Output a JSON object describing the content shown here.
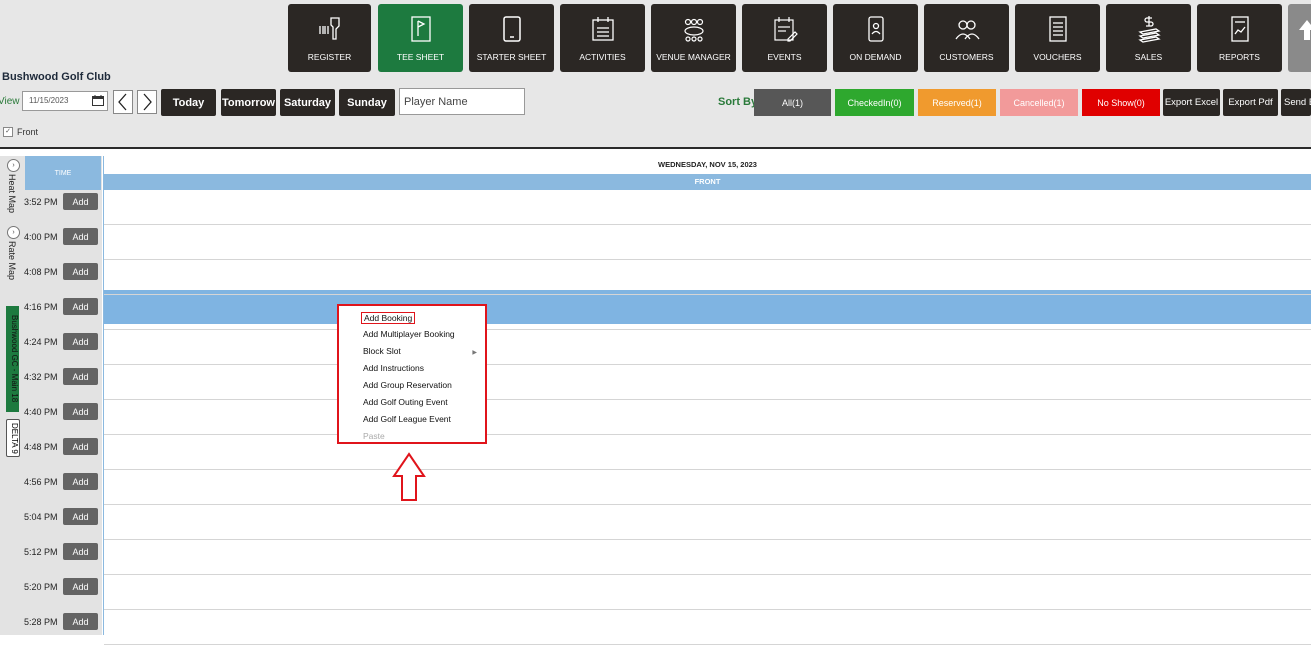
{
  "nav": [
    {
      "label": "REGISTER",
      "icon": "barcode-scanner-icon"
    },
    {
      "label": "TEE SHEET",
      "icon": "flag-sheet-icon"
    },
    {
      "label": "STARTER SHEET",
      "icon": "tablet-icon"
    },
    {
      "label": "ACTIVITIES",
      "icon": "calendar-list-icon"
    },
    {
      "label": "VENUE MANAGER",
      "icon": "people-table-icon"
    },
    {
      "label": "EVENTS",
      "icon": "calendar-edit-icon"
    },
    {
      "label": "ON DEMAND",
      "icon": "phone-person-icon"
    },
    {
      "label": "CUSTOMERS",
      "icon": "users-icon"
    },
    {
      "label": "VOUCHERS",
      "icon": "document-list-icon"
    },
    {
      "label": "SALES",
      "icon": "money-stack-icon"
    },
    {
      "label": "REPORTS",
      "icon": "report-chart-icon"
    }
  ],
  "club_name": "Bushwood Golf Club",
  "view_label": "View",
  "date_value": "11/15/2023",
  "day_buttons": [
    "Today",
    "Tomorrow",
    "Saturday",
    "Sunday"
  ],
  "player_placeholder": "Player Name",
  "sort_label": "Sort By",
  "sort_buttons": [
    {
      "label": "All(1)",
      "color": "#575757"
    },
    {
      "label": "CheckedIn(0)",
      "color": "#2ea82e"
    },
    {
      "label": "Reserved(1)",
      "color": "#f09a2e"
    },
    {
      "label": "Cancelled(1)",
      "color": "#f29a9a"
    },
    {
      "label": "No Show(0)",
      "color": "#e00000"
    }
  ],
  "export_buttons": [
    "Export Excel",
    "Export Pdf",
    "Send E"
  ],
  "front_checkbox_label": "Front",
  "side_tabs": {
    "heat_map": "Heat Map",
    "rate_map": "Rate Map",
    "course": "Bushwood GC - Main 18",
    "delta": "DELTA 9"
  },
  "time_header": "TIME",
  "date_header": "WEDNESDAY, NOV 15, 2023",
  "front_header": "FRONT",
  "add_label": "Add",
  "times": [
    "3:52 PM",
    "4:00 PM",
    "4:08 PM",
    "4:16 PM",
    "4:24 PM",
    "4:32 PM",
    "4:40 PM",
    "4:48 PM",
    "4:56 PM",
    "5:04 PM",
    "5:12 PM",
    "5:20 PM",
    "5:28 PM"
  ],
  "context_menu": [
    "Add Booking",
    "Add Multiplayer Booking",
    "Block Slot",
    "Add Instructions",
    "Add Group Reservation",
    "Add Golf Outing Event",
    "Add Golf League Event",
    "Paste"
  ],
  "colors": {
    "nav_dark": "#2b2724",
    "nav_active": "#1d7a3f",
    "header_blue": "#8bb9df",
    "row_highlight": "#7fb4e2",
    "annotation_red": "#e0141b"
  }
}
